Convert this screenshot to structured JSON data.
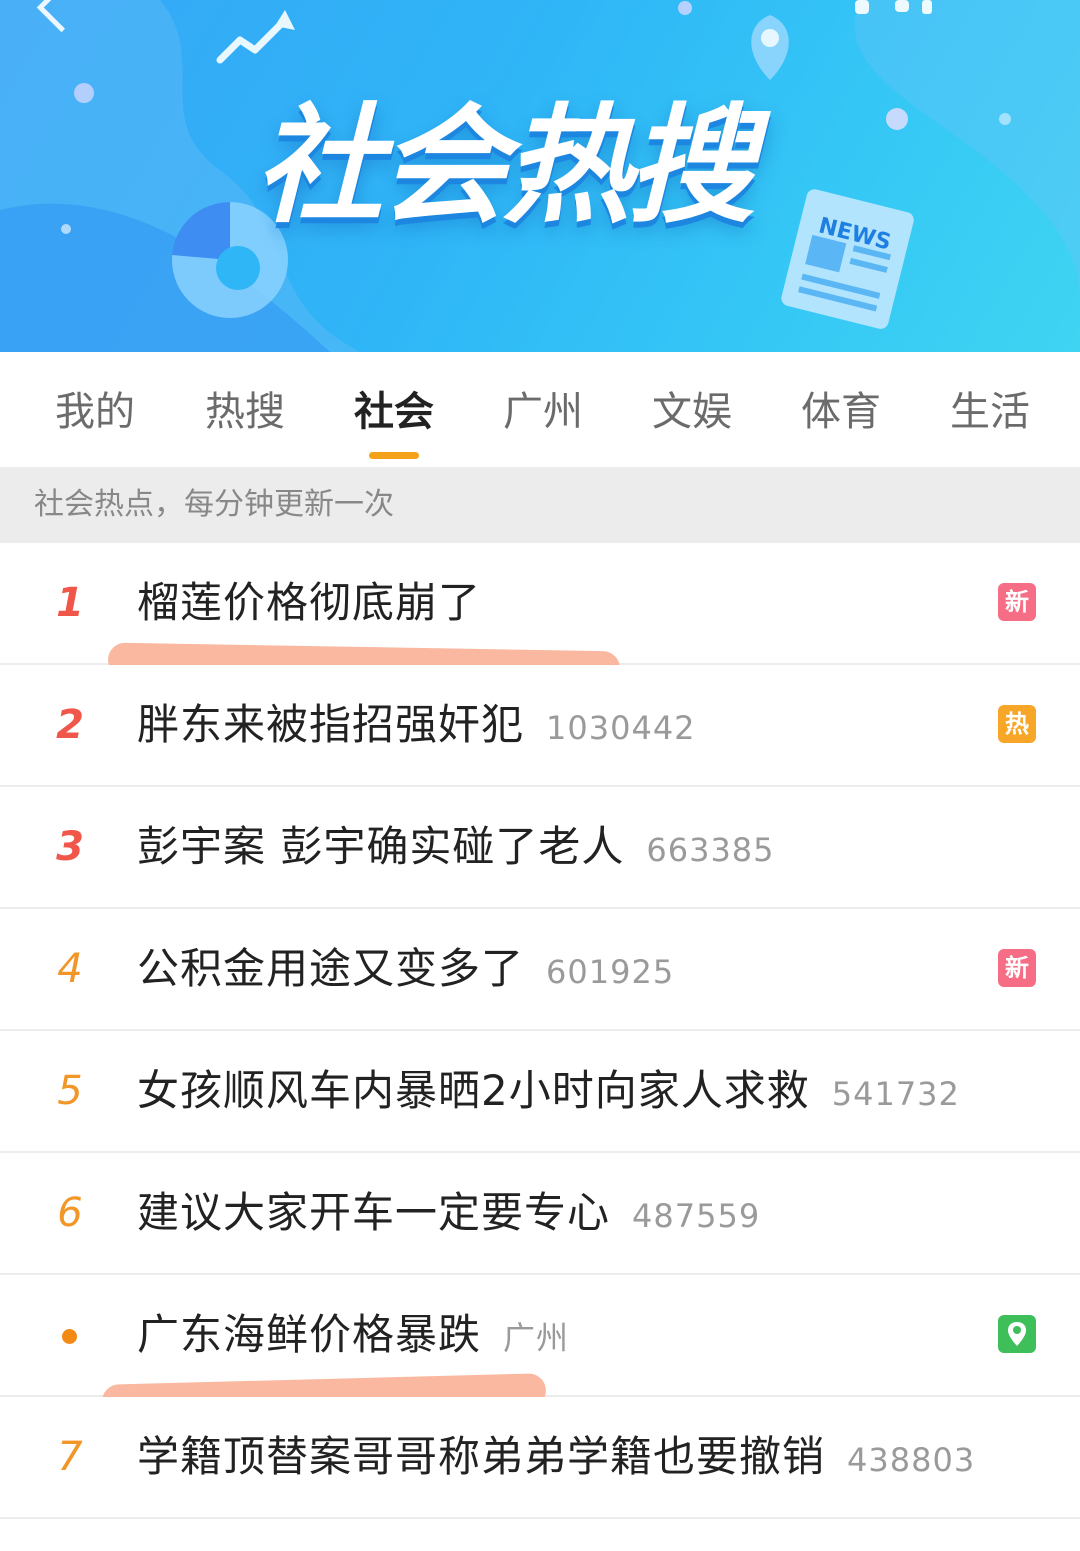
{
  "banner": {
    "title": "社会热搜",
    "news_label": "NEWS"
  },
  "tabs": [
    {
      "label": "我的",
      "active": false
    },
    {
      "label": "热搜",
      "active": false
    },
    {
      "label": "社会",
      "active": true
    },
    {
      "label": "广州",
      "active": false
    },
    {
      "label": "文娱",
      "active": false
    },
    {
      "label": "体育",
      "active": false
    },
    {
      "label": "生活",
      "active": false
    }
  ],
  "subheader": "社会热点，每分钟更新一次",
  "list": [
    {
      "rank": "1",
      "title": "榴莲价格彻底崩了",
      "count": "",
      "badge": "新",
      "badge_type": "new"
    },
    {
      "rank": "2",
      "title": "胖东来被指招强奸犯",
      "count": "1030442",
      "badge": "热",
      "badge_type": "hot"
    },
    {
      "rank": "3",
      "title": "彭宇案 彭宇确实碰了老人",
      "count": "663385",
      "badge": "",
      "badge_type": ""
    },
    {
      "rank": "4",
      "title": "公积金用途又变多了",
      "count": "601925",
      "badge": "新",
      "badge_type": "new"
    },
    {
      "rank": "5",
      "title": "女孩顺风车内暴晒2小时向家人求救",
      "count": "541732",
      "badge": "",
      "badge_type": ""
    },
    {
      "rank": "6",
      "title": "建议大家开车一定要专心",
      "count": "487559",
      "badge": "",
      "badge_type": ""
    },
    {
      "rank": "",
      "title": "广东海鲜价格暴跌",
      "count": "广州",
      "badge": "",
      "badge_type": "loc"
    },
    {
      "rank": "7",
      "title": "学籍顶替案哥哥称弟弟学籍也要撤销",
      "count": "438803",
      "badge": "",
      "badge_type": ""
    }
  ],
  "colors": {
    "rank_top": "#f0564a",
    "rank_mid": "#f29627",
    "tab_indicator": "#f4a21a",
    "badge_new": "#f56e86",
    "badge_hot": "#f7a628",
    "badge_location": "#3fbf5a",
    "highlight": "#f9b49a"
  }
}
